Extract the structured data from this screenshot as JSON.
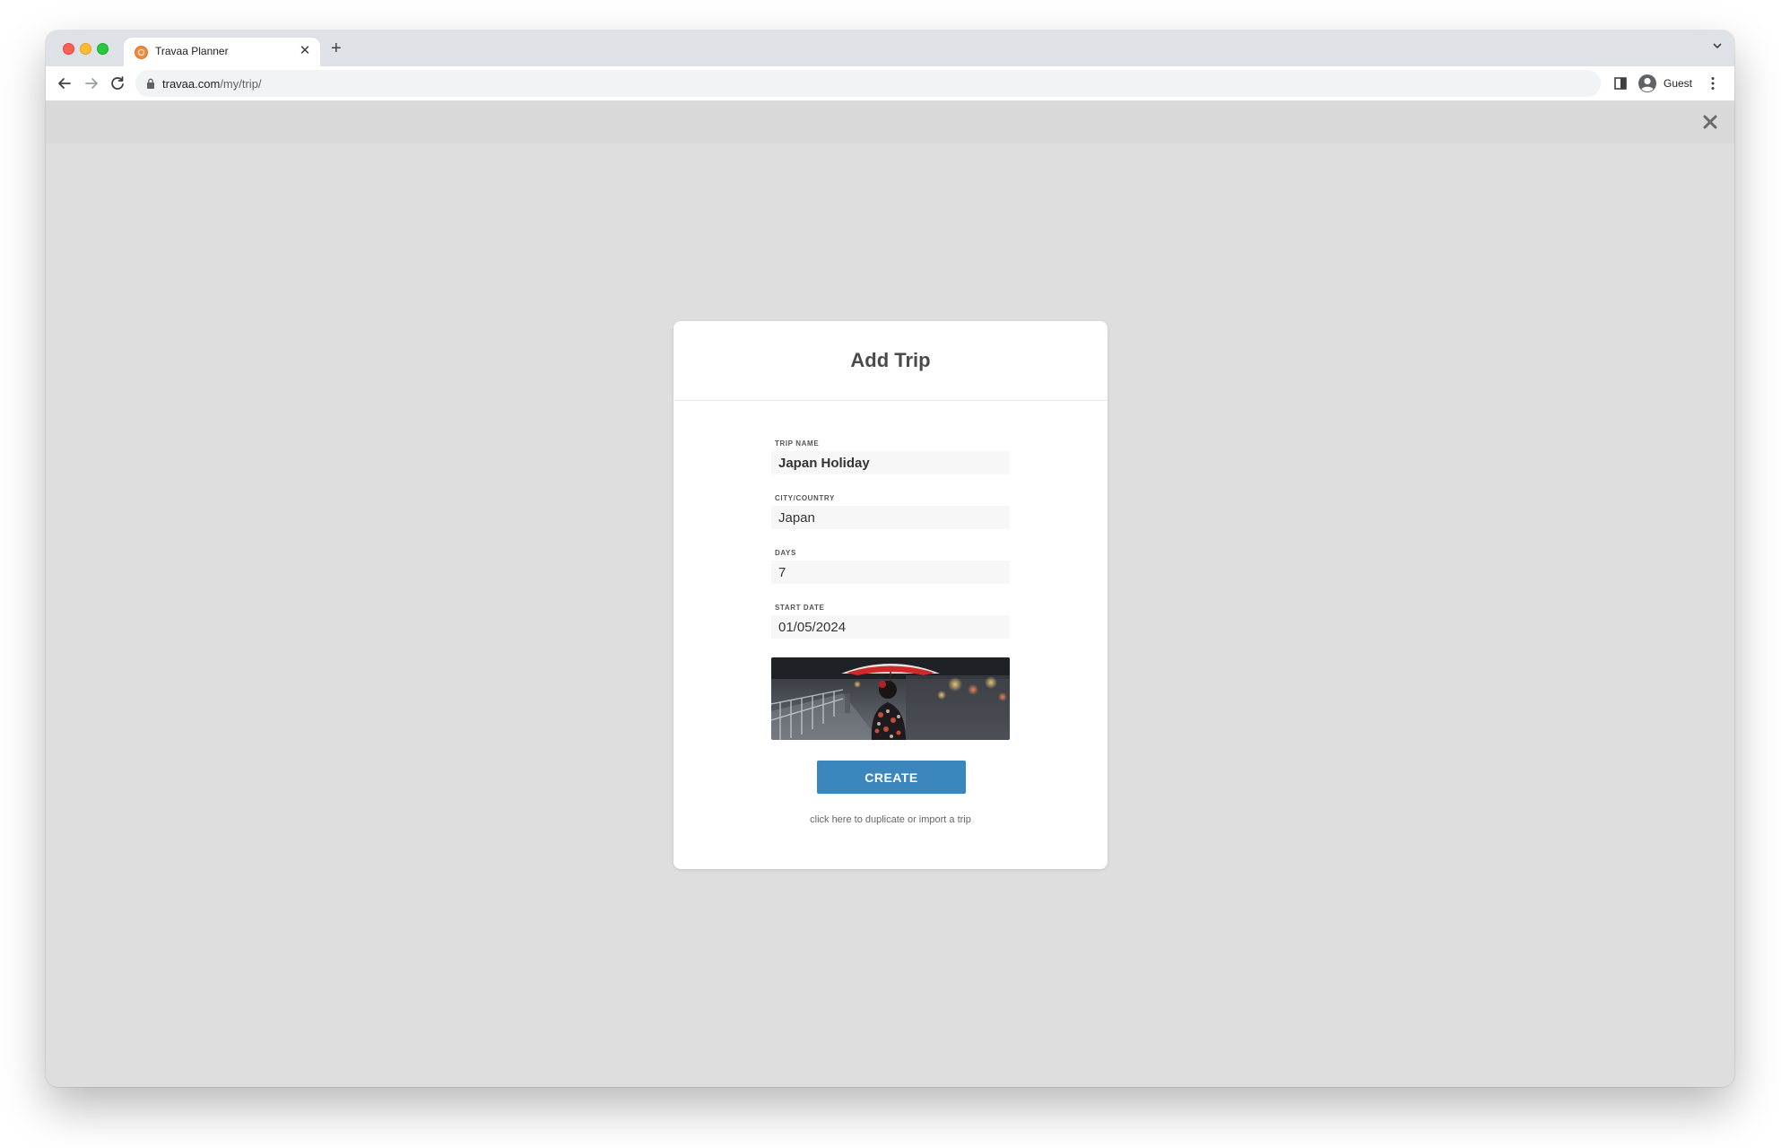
{
  "browser": {
    "tab_title": "Travaa Planner",
    "url_host": "travaa.com",
    "url_path": "/my/trip/",
    "profile_label": "Guest"
  },
  "modal": {
    "title": "Add Trip",
    "fields": {
      "trip_name": {
        "label": "TRIP NAME",
        "value": "Japan Holiday"
      },
      "city_country": {
        "label": "CITY/COUNTRY",
        "value": "Japan"
      },
      "days": {
        "label": "DAYS",
        "value": "7"
      },
      "start_date": {
        "label": "START DATE",
        "value": "01/05/2024"
      }
    },
    "create_label": "CREATE",
    "import_link": "click here to duplicate or import a trip"
  },
  "colors": {
    "accent": "#3b87bd",
    "overlay": "#dedede"
  },
  "icons": {
    "favicon": "travaa-logo-icon",
    "back": "arrow-left-icon",
    "forward": "arrow-right-icon",
    "reload": "reload-icon",
    "lock": "lock-icon",
    "reading_list": "side-panel-icon",
    "avatar": "account-circle-icon",
    "menu": "kebab-menu-icon",
    "close_overlay": "close-icon"
  }
}
